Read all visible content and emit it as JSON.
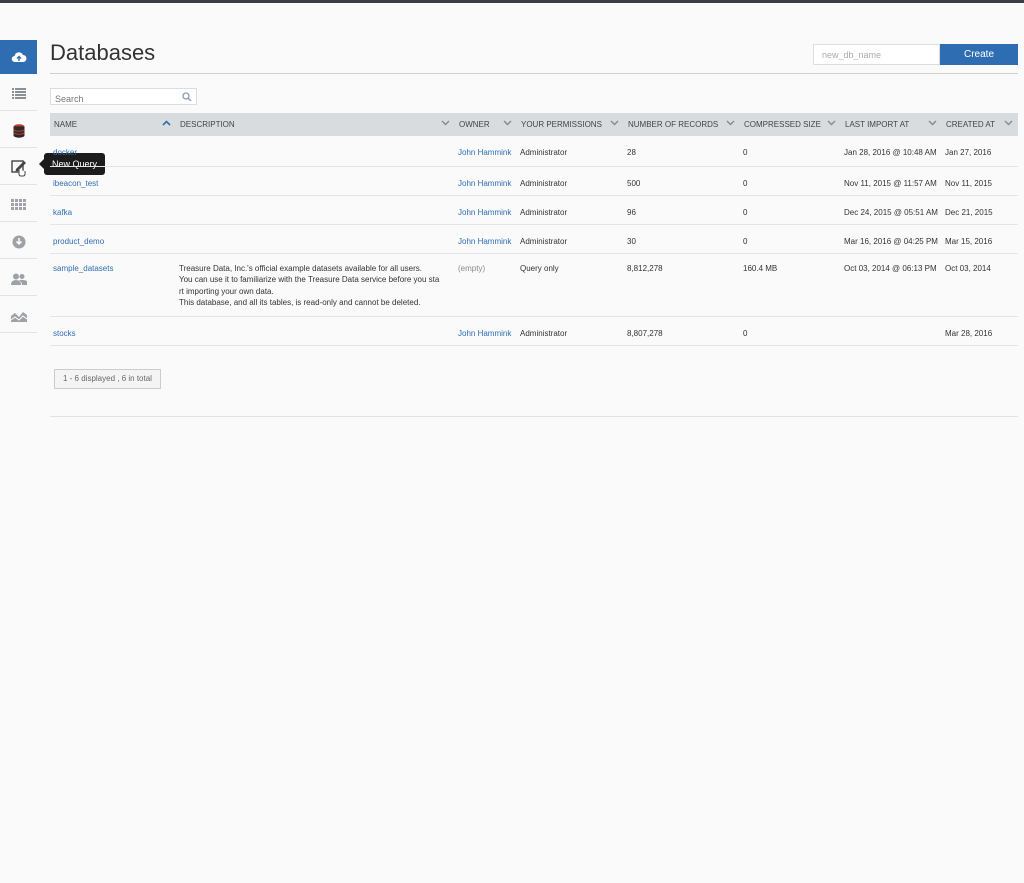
{
  "page": {
    "title": "Databases",
    "new_db_placeholder": "new_db_name",
    "create_label": "Create",
    "search_placeholder": "Search",
    "pagination": "1 - 6 displayed , 6 in total"
  },
  "tooltip": {
    "text": "New Query"
  },
  "sidebar": {
    "items": [
      {
        "icon": "cloud-upload-icon",
        "active": true
      },
      {
        "icon": "list-icon"
      },
      {
        "icon": "database-icon"
      },
      {
        "icon": "new-query-icon"
      },
      {
        "icon": "grid-icon"
      },
      {
        "icon": "download-icon"
      },
      {
        "icon": "users-icon"
      },
      {
        "icon": "chart-icon"
      }
    ]
  },
  "table": {
    "columns": [
      "NAME",
      "DESCRIPTION",
      "OWNER",
      "YOUR PERMISSIONS",
      "NUMBER OF RECORDS",
      "COMPRESSED SIZE",
      "LAST IMPORT AT",
      "CREATED AT"
    ],
    "rows": [
      {
        "name": "docker",
        "desc": "",
        "owner": "John Hammink",
        "perm": "Administrator",
        "records": "28",
        "size": "0",
        "last": "Jan 28, 2016 @ 10:48 AM",
        "created": "Jan 27, 2016"
      },
      {
        "name": "ibeacon_test",
        "desc": "",
        "owner": "John Hammink",
        "perm": "Administrator",
        "records": "500",
        "size": "0",
        "last": "Nov 11, 2015 @ 11:57 AM",
        "created": "Nov 11, 2015"
      },
      {
        "name": "kafka",
        "desc": "",
        "owner": "John Hammink",
        "perm": "Administrator",
        "records": "96",
        "size": "0",
        "last": "Dec 24, 2015 @ 05:51 AM",
        "created": "Dec 21, 2015"
      },
      {
        "name": "product_demo",
        "desc": "",
        "owner": "John Hammink",
        "perm": "Administrator",
        "records": "30",
        "size": "0",
        "last": "Mar 16, 2016 @ 04:25 PM",
        "created": "Mar 15, 2016"
      },
      {
        "name": "sample_datasets",
        "desc1": "Treasure Data, Inc.'s official example datasets available for all users.",
        "desc2": "You can use it to familiarize with the Treasure Data service before you sta",
        "desc3": "rt importing your own data.",
        "desc4": "This database, and all its tables, is read-only and cannot be deleted.",
        "owner": "(empty)",
        "perm": "Query only",
        "records": "8,812,278",
        "size": "160.4 MB",
        "last": "Oct 03, 2014 @ 06:13 PM",
        "created": "Oct 03, 2014"
      },
      {
        "name": "stocks",
        "desc": "",
        "owner": "John Hammink",
        "perm": "Administrator",
        "records": "8,807,278",
        "size": "0",
        "last": "",
        "created": "Mar 28, 2016"
      }
    ]
  }
}
